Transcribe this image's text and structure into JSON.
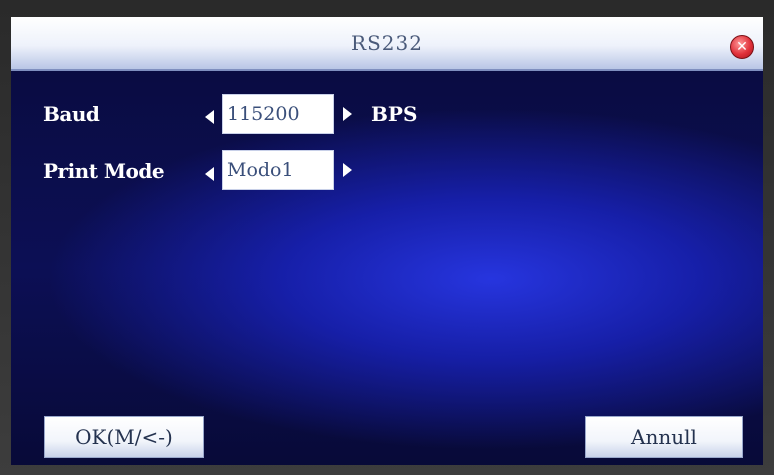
{
  "window": {
    "title": "RS232",
    "close_icon": "close-icon"
  },
  "settings": {
    "baud": {
      "label": "Baud",
      "value": "115200",
      "unit": "BPS"
    },
    "print_mode": {
      "label": "Print Mode",
      "value": "Modo1"
    }
  },
  "buttons": {
    "ok_label": "OK(M/<-)",
    "cancel_label": "Annull"
  },
  "colors": {
    "screen_background": "#0c0f55",
    "glow": "#2837e6",
    "titlebar": "#eef2fb",
    "close_button": "#e0303a"
  }
}
